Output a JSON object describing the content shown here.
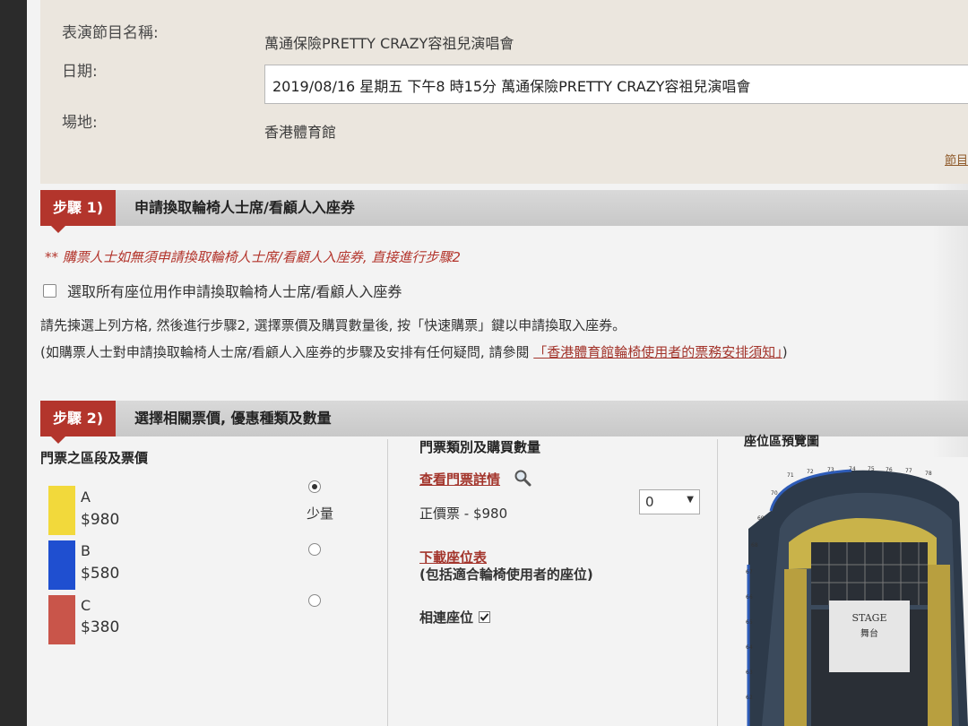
{
  "event": {
    "name_label": "表演節目名稱:",
    "name_value": "萬通保險PRETTY CRAZY容祖兒演唱會",
    "date_label": "日期:",
    "date_value": "2019/08/16 星期五 下午8 時15分 萬通保險PRETTY CRAZY容祖兒演唱會",
    "venue_label": "場地:",
    "venue_value": "香港體育館",
    "corner_link": "節目"
  },
  "step1": {
    "badge": "步驟 1)",
    "title": "申請換取輪椅人士席/看顧人入座券",
    "note": "** 購票人士如無須申請換取輪椅人士席/看顧人入座券, 直接進行步驟2",
    "checkbox_label": "選取所有座位用作申請換取輪椅人士席/看顧人入座券",
    "instruction": "請先揀選上列方格, 然後進行步驟2, 選擇票價及購買數量後, 按「快速購票」鍵以申請換取入座券。",
    "help_prefix": "(如購票人士對申請換取輪椅人士席/看顧人入座券的步驟及安排有任何疑問, 請參閱",
    "help_link": "「香港體育館輪椅使用者的票務安排須知」",
    "help_suffix": ")"
  },
  "step2": {
    "badge": "步驟 2)",
    "title": "選擇相關票價, 優惠種類及數量",
    "col1_title": "門票之區段及票價",
    "categories": [
      {
        "letter": "A",
        "price": "$980",
        "color": "#f2d93b"
      },
      {
        "letter": "B",
        "price": "$580",
        "color": "#1f4fd0"
      },
      {
        "letter": "C",
        "price": "$380",
        "color": "#c9554a"
      }
    ],
    "low_label": "少量",
    "col2_title": "門票類別及購買數量",
    "view_details": "查看門票詳情",
    "ticket_type": "正價票 - $980",
    "qty_value": "0",
    "download_map": "下載座位表",
    "download_note": "(包括適合輪椅使用者的座位)",
    "adjacent": "相連座位",
    "col3_title": "座位區預覽圖",
    "stage_en": "STAGE",
    "stage_zh": "舞台"
  }
}
